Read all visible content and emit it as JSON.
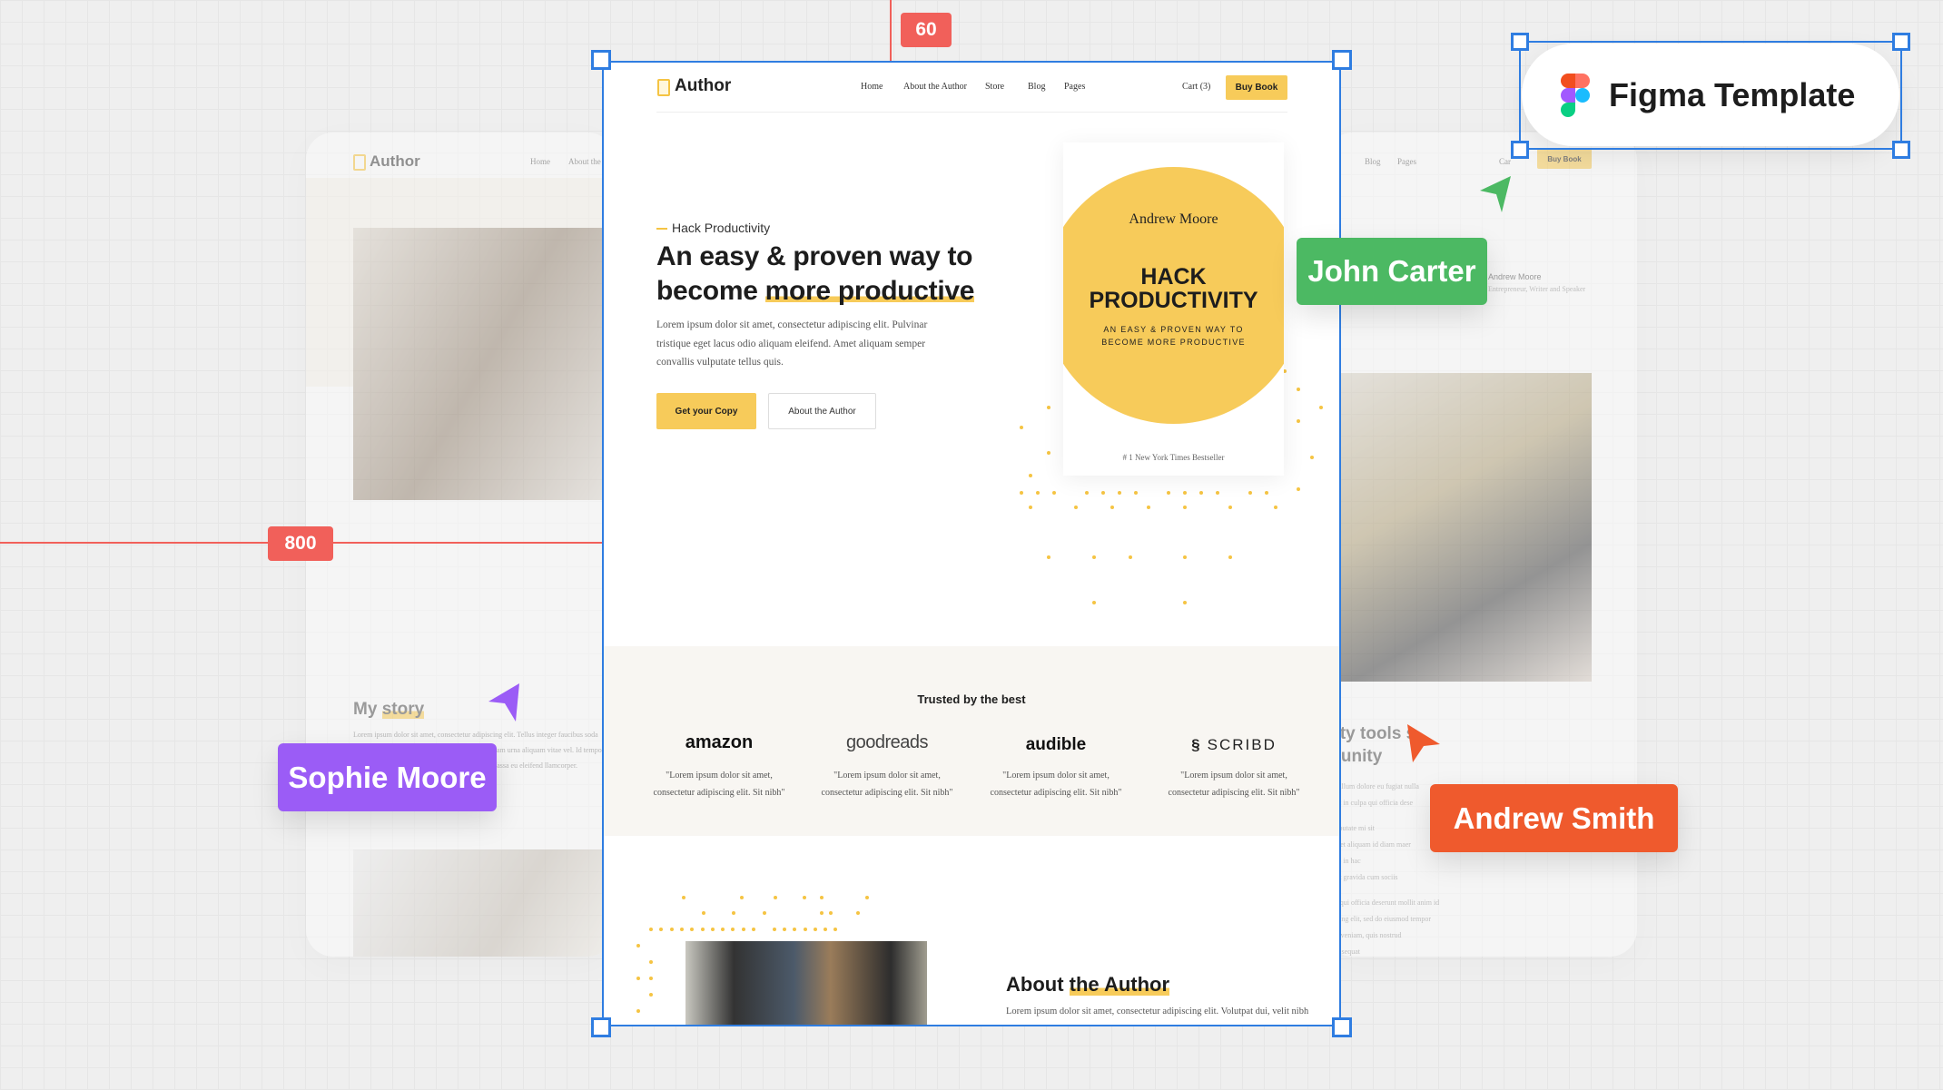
{
  "rulers": {
    "top_value": "60",
    "left_value": "800"
  },
  "badge": {
    "label": "Figma Template",
    "icon": "figma-logo"
  },
  "collaborators": [
    {
      "name": "John Carter",
      "color": "#4cb963"
    },
    {
      "name": "Sophie Moore",
      "color": "#9b5cf6"
    },
    {
      "name": "Andrew Smith",
      "color": "#ef5a2d"
    }
  ],
  "site": {
    "logo": "Author",
    "nav": [
      "Home",
      "About the Author",
      "Store",
      "Blog",
      "Pages"
    ],
    "cart": "Cart (3)",
    "buy": "Buy Book",
    "accent": "#f7cb5a",
    "hero": {
      "eyebrow": "Hack Productivity",
      "title_line1": "An easy & proven way to",
      "title_line2_plain": "become ",
      "title_line2_highlight": "more productive",
      "body": "Lorem ipsum dolor sit amet, consectetur adipiscing elit. Pulvinar tristique eget lacus odio aliquam eleifend. Amet aliquam semper convallis vulputate tellus quis.",
      "primary_button": "Get your Copy",
      "secondary_button": "About the Author"
    },
    "book": {
      "author": "Andrew Moore",
      "title_line1": "HACK",
      "title_line2": "PRODUCTIVITY",
      "subtitle_line1": "AN EASY & PROVEN WAY TO",
      "subtitle_line2": "BECOME MORE PRODUCTIVE",
      "tagline": "# 1 New York Times Bestseller"
    },
    "trusted": {
      "title": "Trusted by the best",
      "items": [
        {
          "logo": "amazon",
          "quote1": "\"Lorem ipsum dolor sit amet,",
          "quote2": "consectetur adipiscing elit. Sit nibh\""
        },
        {
          "logo": "goodreads",
          "quote1": "\"Lorem ipsum dolor sit amet,",
          "quote2": "consectetur adipiscing elit. Sit nibh\""
        },
        {
          "logo": "audible",
          "quote1": "\"Lorem ipsum dolor sit amet,",
          "quote2": "consectetur adipiscing elit. Sit nibh\""
        },
        {
          "logo": "SCRIBD",
          "quote1": "\"Lorem ipsum dolor sit amet,",
          "quote2": "consectetur adipiscing elit. Sit nibh\""
        }
      ]
    },
    "about": {
      "title_plain": "About ",
      "title_highlight": "the Author",
      "body": "Lorem ipsum dolor sit amet, consectetur adipiscing elit. Volutpat dui, velit nibh"
    }
  },
  "left_page": {
    "logo": "Author",
    "nav": [
      "Home",
      "About the A"
    ],
    "story_plain": "My ",
    "story_highlight": "story",
    "story_body": "Lorem ipsum dolor sit amet, consectetur adipiscing elit. Tellus integer faucibus soda volutpat in ac lectus. Porttitor a eu, ante libero quam urna aliquam vitae vel. Id tempo et mi adipiscing dapibus dictum nare tellus vitae. Massa eu eleifend llamcorper."
  },
  "right_page": {
    "nav": [
      "Blog",
      "Pages"
    ],
    "cart": "Car",
    "buy": "Buy Book",
    "author_name": "Andrew Moore",
    "author_role": "Entrepreneur, Writer and Speaker",
    "heading1": "vity tools  s",
    "heading2": "munity",
    "lines": [
      "sse cillum dolore eu fugiat nulla",
      ", sunt in culpa qui officia dese",
      "l vulputate mi sit",
      "it amet aliquam id diam maer",
      "tellus in hac",
      "t eget gravida cum sociis",
      "ulpa qui officia deserunt mollit anim id",
      "ipiscing elit, sed do eiusmod tempor",
      "inim veniam, quis nostrud",
      "o consequat"
    ]
  }
}
